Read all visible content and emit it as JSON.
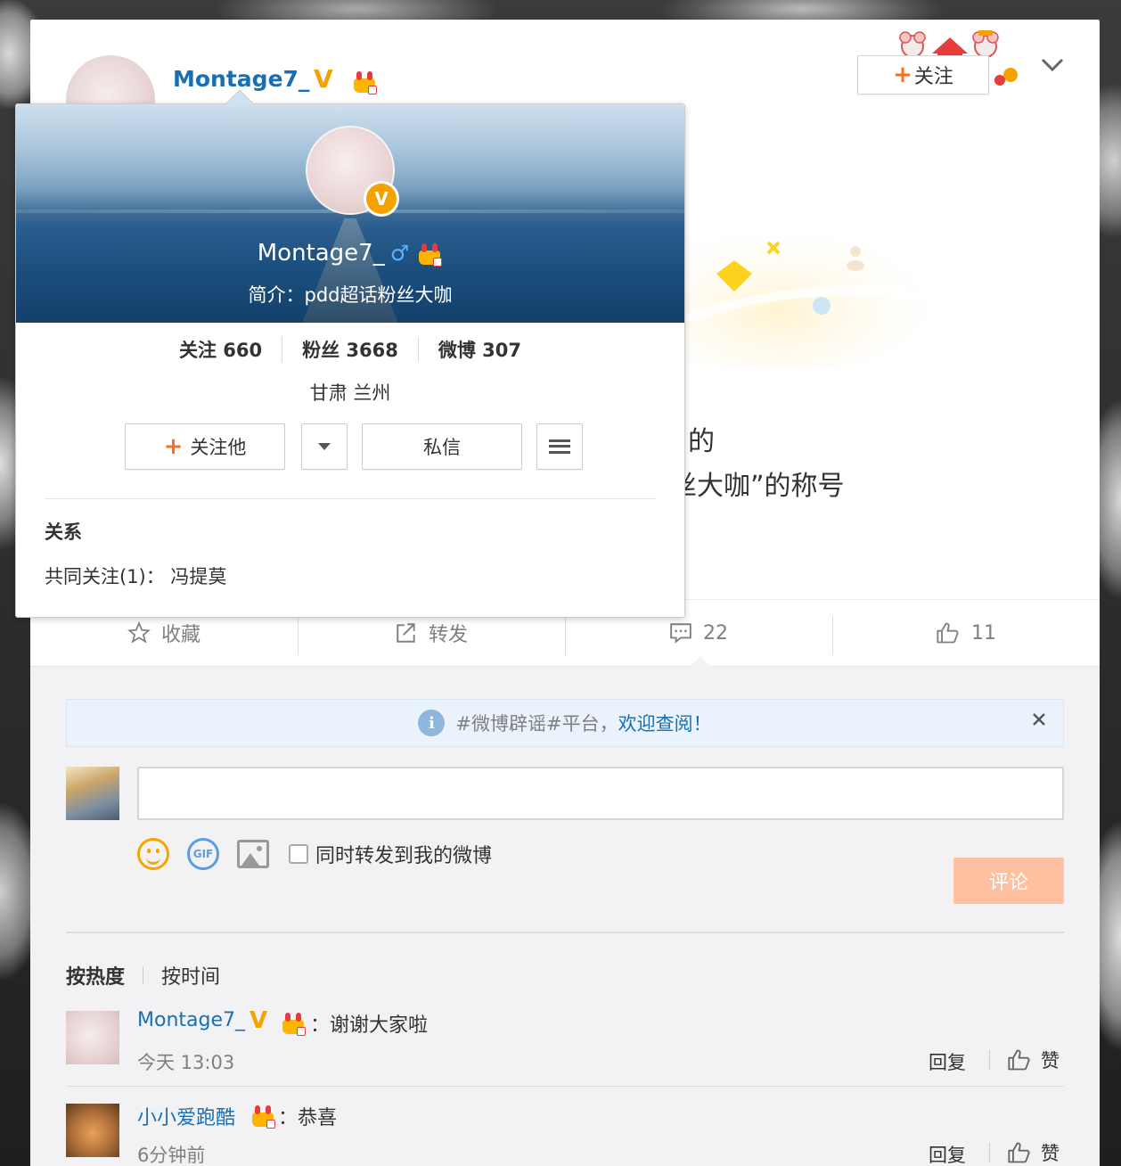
{
  "post": {
    "username": "Montage7_",
    "follow_label": "关注",
    "text_line1": "的",
    "text_line2": "丝大咖”的称号"
  },
  "actions": {
    "favorite": "收藏",
    "repost": "转发",
    "comments_count": "22",
    "likes_count": "11"
  },
  "notice": {
    "prefix": "#微博辟谣#平台，",
    "link": "欢迎查阅！"
  },
  "composer": {
    "repost_checkbox_label": "同时转发到我的微博",
    "submit_label": "评论"
  },
  "sort": {
    "hot": "按热度",
    "time": "按时间"
  },
  "comments": [
    {
      "name": "Montage7_",
      "text": "：谢谢大家啦",
      "time": "今天 13:03",
      "reply": "回复",
      "like": "赞"
    },
    {
      "name": "小小爱跑酷",
      "text": "：恭喜",
      "time": "6分钟前",
      "reply": "回复",
      "like": "赞"
    }
  ],
  "popup": {
    "name": "Montage7_",
    "gender_symbol": "♂",
    "verified_badge": "V",
    "intro": "简介：pdd超话粉丝大咖",
    "stats": {
      "following": "关注 660",
      "fans": "粉丝 3668",
      "weibo": "微博 307"
    },
    "location": "甘肃 兰州",
    "follow_button": "关注他",
    "message_button": "私信",
    "relation_title": "关系",
    "mutual_follow": "共同关注(1)：  冯提莫"
  },
  "colors": {
    "link_blue": "#1a6fb0",
    "accent_orange": "#ff6d22",
    "verified_gold": "#f3a200",
    "submit_disabled": "#ffc09f"
  },
  "icons": [
    "chevron-down-icon",
    "star-icon",
    "share-icon",
    "comment-icon",
    "thumbs-up-icon",
    "info-icon",
    "close-icon",
    "emoji-icon",
    "gif-icon",
    "image-icon",
    "menu-icon",
    "crown-icon"
  ]
}
